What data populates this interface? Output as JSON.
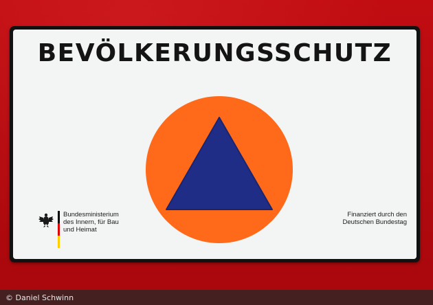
{
  "sign": {
    "title": "BEVÖLKERUNGSSCHUTZ",
    "emblem": {
      "icon": "civil-defence-triangle-icon",
      "circle_color": "#ff6a1a",
      "triangle_color": "#1f2d86"
    },
    "ministry": {
      "logo_icon": "federal-eagle-icon",
      "lines": [
        "Bundesministerium",
        "des Innern, für Bau",
        "und Heimat"
      ],
      "flag_colors": [
        "#000000",
        "#dd0000",
        "#ffce00"
      ]
    },
    "funding": {
      "lines": [
        "Finanziert durch den",
        "Deutschen Bundestag"
      ]
    }
  },
  "background": {
    "vehicle_color": "#b40a0f"
  },
  "credit": {
    "text": "© Daniel Schwinn"
  }
}
